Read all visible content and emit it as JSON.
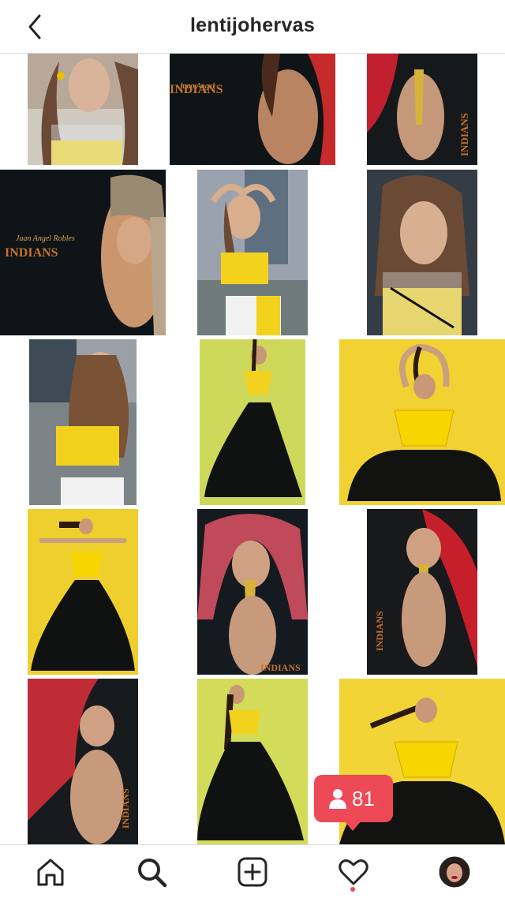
{
  "header": {
    "title": "lentijohervas"
  },
  "grid": {
    "photos": [
      {
        "desc": "Woman in clear plastic top, yellow bra, hand near face",
        "watermark": ""
      },
      {
        "desc": "Woman with red feathered headdress, dark background",
        "watermark": "INDIANS"
      },
      {
        "desc": "Woman with red feathered headdress, dark background",
        "watermark": "INDIANS"
      },
      {
        "desc": "Woman in feather headdress, dark background",
        "watermark": "INDIANS"
      },
      {
        "desc": "Woman in yellow top, arms raised, city background",
        "watermark": ""
      },
      {
        "desc": "Woman in clear plastic top, hands on chest",
        "watermark": ""
      },
      {
        "desc": "Woman in yellow top, curly hair, bridge background",
        "watermark": ""
      },
      {
        "desc": "Woman in yellow bow and black tulle skirt on yellow-green",
        "watermark": ""
      },
      {
        "desc": "Woman with yellow bow sitting on black tulle, yellow backdrop",
        "watermark": ""
      },
      {
        "desc": "Woman with yellow bow and black tulle skirt, yellow backdrop",
        "watermark": ""
      },
      {
        "desc": "Woman in pink-red feather headdress, dark background",
        "watermark": "INDIANS"
      },
      {
        "desc": "Woman in red headdress, dark background",
        "watermark": "INDIANS"
      },
      {
        "desc": "Woman in red headdress, dark background",
        "watermark": "INDIANS"
      },
      {
        "desc": "Woman with yellow bow and black tulle skirt, yellow-green backdrop",
        "watermark": ""
      },
      {
        "desc": "Woman with yellow bow sitting on black tulle, yellow backdrop",
        "watermark": ""
      }
    ]
  },
  "notification": {
    "count": "81",
    "icon": "person-icon",
    "color": "#ed4956"
  },
  "tabbar": {
    "items": [
      {
        "name": "home-icon"
      },
      {
        "name": "search-icon"
      },
      {
        "name": "add-post-icon"
      },
      {
        "name": "heart-icon"
      },
      {
        "name": "profile-avatar"
      }
    ]
  }
}
